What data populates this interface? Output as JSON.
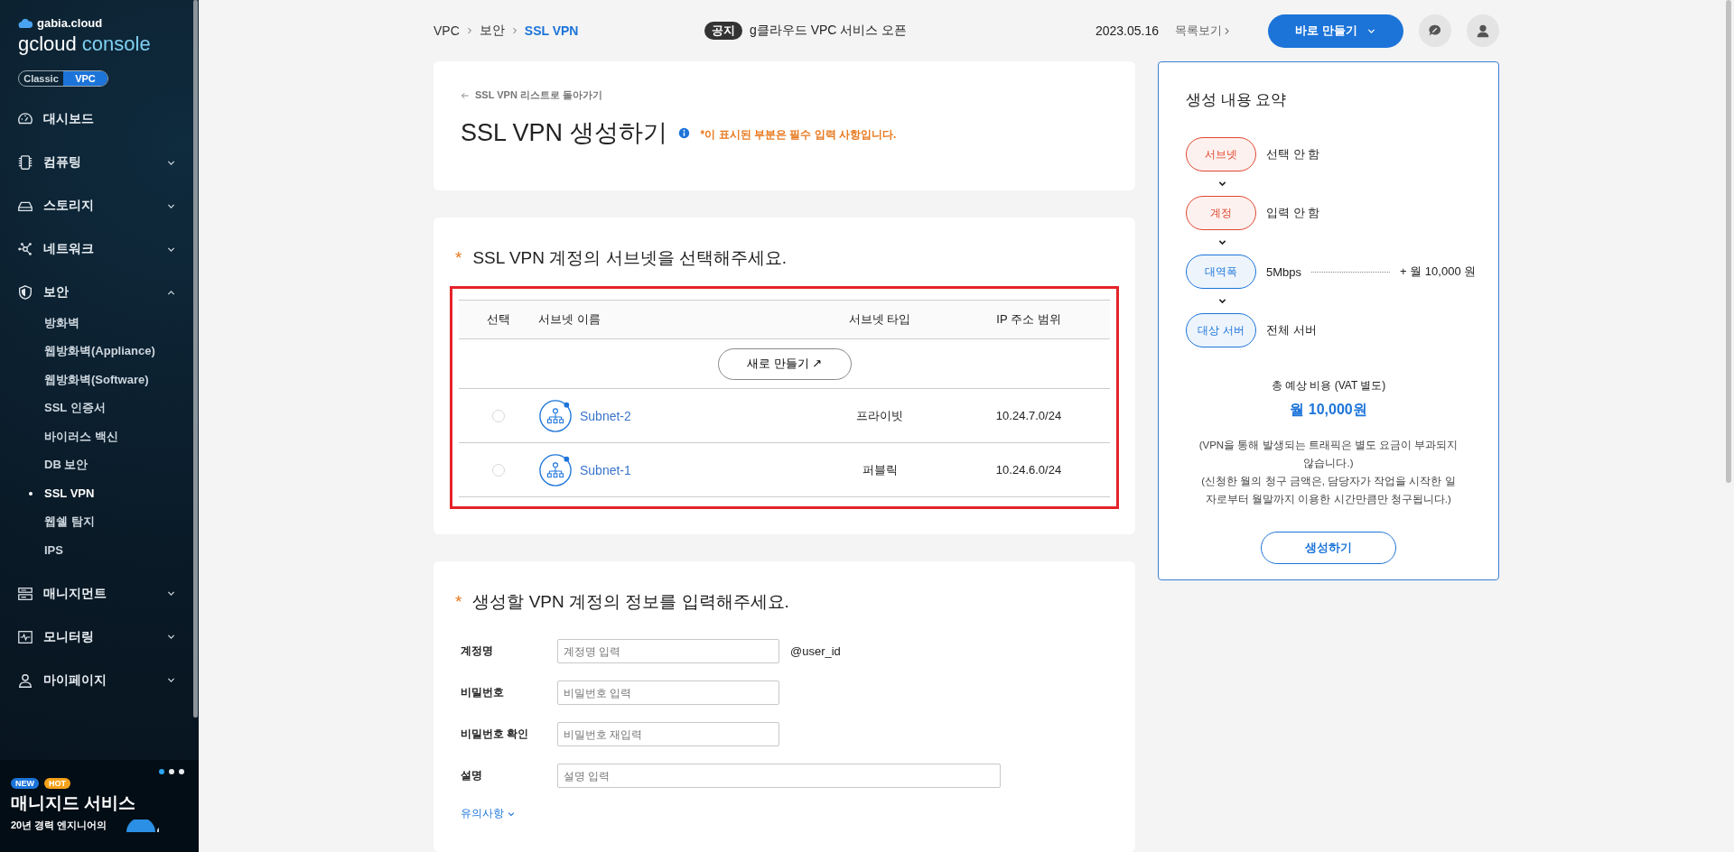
{
  "sidebar": {
    "logo": {
      "brand": "gabia.cloud",
      "product": "gcloud",
      "product_suffix": "console"
    },
    "mode_toggle": [
      {
        "label": "Classic",
        "selected": false
      },
      {
        "label": "VPC",
        "selected": true
      }
    ],
    "menu": [
      {
        "label": "대시보드"
      },
      {
        "label": "컴퓨팅",
        "expanded": false
      },
      {
        "label": "스토리지",
        "expanded": false
      },
      {
        "label": "네트워크",
        "expanded": false
      },
      {
        "label": "보안",
        "expanded": true,
        "children": [
          {
            "label": "방화벽",
            "selected": false
          },
          {
            "label": "웹방화벽(Appliance)",
            "selected": false
          },
          {
            "label": "웹방화벽(Software)",
            "selected": false
          },
          {
            "label": "SSL 인증서",
            "selected": false
          },
          {
            "label": "바이러스 백신",
            "selected": false
          },
          {
            "label": "DB 보안",
            "selected": false
          },
          {
            "label": "SSL VPN",
            "selected": true
          },
          {
            "label": "웹쉘 탐지",
            "selected": false
          },
          {
            "label": "IPS",
            "selected": false
          }
        ]
      },
      {
        "label": "매니지먼트",
        "expanded": false
      },
      {
        "label": "모니터링",
        "expanded": false
      },
      {
        "label": "마이페이지",
        "expanded": false
      }
    ],
    "banner": {
      "dots": [
        {
          "selected": true
        },
        {
          "selected": false
        },
        {
          "selected": false
        }
      ],
      "badges": [
        {
          "label": "NEW",
          "color": "#1c74d9"
        },
        {
          "label": "HOT",
          "color": "#f5a21b"
        }
      ],
      "title": "매니지드 서비스",
      "subtitle": "20년 경력 엔지니어의"
    }
  },
  "topbar": {
    "breadcrumb": [
      {
        "label": "VPC",
        "current": false
      },
      {
        "label": "보안",
        "current": false
      },
      {
        "label": "SSL VPN",
        "current": true
      }
    ],
    "notice": {
      "tag": "공지",
      "text": "g클라우드 VPC 서비스 오픈",
      "date": "2023.05.16",
      "more_link": "목록보기"
    },
    "create_button": "바로 만들기"
  },
  "header": {
    "back_link": "SSL VPN 리스트로 돌아가기",
    "title": "SSL VPN 생성하기",
    "required_note": "*이 표시된 부분은 필수 입력 사항입니다."
  },
  "subnet_section": {
    "required_mark": "*",
    "heading": "SSL VPN 계정의 서브넷을 선택해주세요.",
    "table": {
      "columns": [
        "선택",
        "서브넷 이름",
        "서브넷 타입",
        "IP 주소 범위"
      ],
      "new_button": "새로 만들기 ↗",
      "rows": [
        {
          "selected": false,
          "name": "Subnet-2",
          "type": "프라이빗",
          "ip_range": "10.24.7.0/24"
        },
        {
          "selected": false,
          "name": "Subnet-1",
          "type": "퍼블릭",
          "ip_range": "10.24.6.0/24"
        }
      ]
    }
  },
  "account_section": {
    "required_mark": "*",
    "heading": "생성할 VPN 계정의 정보를 입력해주세요.",
    "fields": [
      {
        "kind": "short",
        "label": "계정명",
        "placeholder": "계정명 입력",
        "suffix": "@user_id"
      },
      {
        "kind": "short",
        "label": "비밀번호",
        "placeholder": "비밀번호 입력"
      },
      {
        "kind": "short",
        "label": "비밀번호 확인",
        "placeholder": "비밀번호 재입력"
      },
      {
        "kind": "long",
        "label": "설명",
        "placeholder": "설명 입력"
      }
    ],
    "notes_link": "유의사항"
  },
  "summary": {
    "title": "생성 내용 요약",
    "steps": [
      {
        "tag": "서브넷",
        "value": "선택 안 함",
        "color": "#e0472f"
      },
      {
        "tag": "계정",
        "value": "입력 안 함",
        "color": "#e0472f"
      },
      {
        "tag": "대역폭",
        "value": "5Mbps",
        "price": "+ 월 10,000 원",
        "color": "#1c74d9"
      },
      {
        "tag": "대상 서버",
        "value": "전체 서버",
        "color": "#1c74d9"
      }
    ],
    "total_label": "총 예상 비용 (VAT 별도)",
    "total": "월 10,000원",
    "notes": [
      "(VPN을 통해 발생되는 트래픽은 별도 요금이 부과되지 않습니다.)",
      "(신청한 월의 청구 금액은, 담당자가 작업을 시작한 일자로부터 월말까지 이용한 시간만큼만 청구됩니다.)"
    ],
    "create_button": "생성하기"
  }
}
